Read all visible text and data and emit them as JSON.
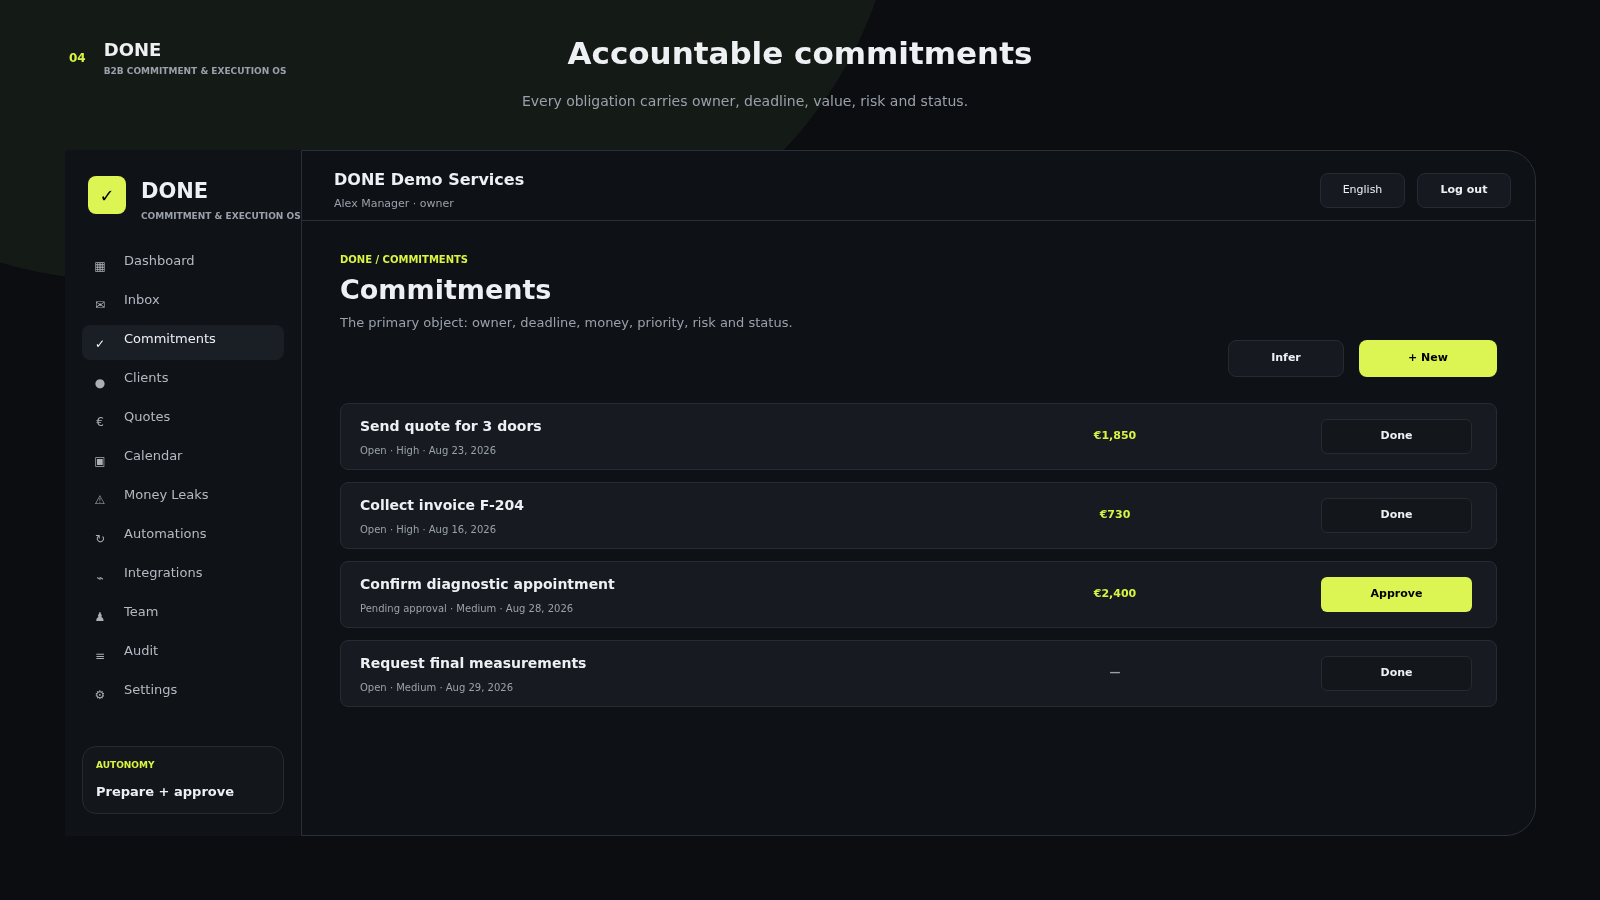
{
  "slide": {
    "number": "04",
    "brand": "DONE",
    "tagline": "B2B COMMITMENT & EXECUTION OS",
    "title": "Accountable commitments",
    "subtitle": "Every obligation carries owner, deadline, value, risk and status."
  },
  "sidebar": {
    "logo_mark": "✓",
    "brand": "DONE",
    "tagline": "COMMITMENT & EXECUTION OS",
    "items": [
      {
        "icon": "▦",
        "label": "Dashboard",
        "selected": false
      },
      {
        "icon": "✉",
        "label": "Inbox",
        "selected": false
      },
      {
        "icon": "✓",
        "label": "Commitments",
        "selected": true
      },
      {
        "icon": "●",
        "label": "Clients",
        "selected": false
      },
      {
        "icon": "€",
        "label": "Quotes",
        "selected": false
      },
      {
        "icon": "▣",
        "label": "Calendar",
        "selected": false
      },
      {
        "icon": "⚠",
        "label": "Money Leaks",
        "selected": false
      },
      {
        "icon": "↻",
        "label": "Automations",
        "selected": false
      },
      {
        "icon": "⌁",
        "label": "Integrations",
        "selected": false
      },
      {
        "icon": "♟",
        "label": "Team",
        "selected": false
      },
      {
        "icon": "≡",
        "label": "Audit",
        "selected": false
      },
      {
        "icon": "⚙",
        "label": "Settings",
        "selected": false
      }
    ],
    "autonomy": {
      "label": "AUTONOMY",
      "value": "Prepare + approve"
    }
  },
  "header": {
    "org": "DONE Demo Services",
    "user": "Alex Manager · owner",
    "buttons": [
      "English",
      "Log out"
    ]
  },
  "page": {
    "breadcrumb": "DONE / COMMITMENTS",
    "title": "Commitments",
    "description": "The primary object: owner, deadline, money, priority, risk and status.",
    "actions": [
      {
        "label": "Infer",
        "kind": "secondary"
      },
      {
        "label": "+ New",
        "kind": "primary"
      }
    ]
  },
  "commitments": [
    {
      "title": "Send quote for 3 doors",
      "meta": "Open · High · Aug 23, 2026",
      "amount": "€1,850",
      "amount_muted": false,
      "action": "Done",
      "kind": "done"
    },
    {
      "title": "Collect invoice F-204",
      "meta": "Open · High · Aug 16, 2026",
      "amount": "€730",
      "amount_muted": false,
      "action": "Done",
      "kind": "done"
    },
    {
      "title": "Confirm diagnostic appointment",
      "meta": "Pending approval · Medium · Aug 28, 2026",
      "amount": "€2,400",
      "amount_muted": false,
      "action": "Approve",
      "kind": "approve"
    },
    {
      "title": "Request final measurements",
      "meta": "Open · Medium · Aug 29, 2026",
      "amount": "—",
      "amount_muted": true,
      "action": "Done",
      "kind": "done"
    }
  ]
}
